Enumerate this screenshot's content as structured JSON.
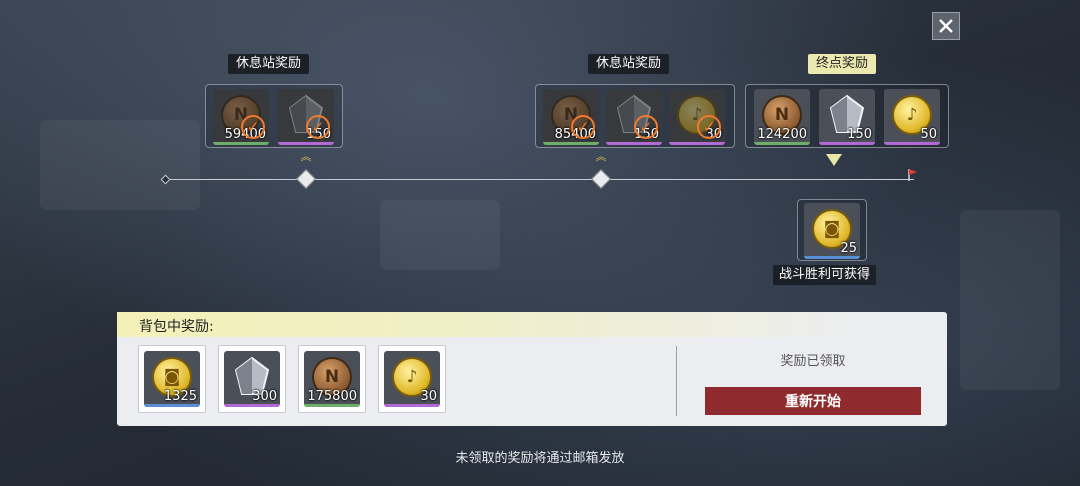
{
  "close_icon": "close-icon",
  "stations": [
    {
      "title": "休息站奖励",
      "items": [
        {
          "icon": "bronze-coin-icon",
          "qty": "59400",
          "claimed": true
        },
        {
          "icon": "crystal-icon",
          "qty": "150",
          "claimed": true
        }
      ]
    },
    {
      "title": "休息站奖励",
      "items": [
        {
          "icon": "bronze-coin-icon",
          "qty": "85400",
          "claimed": true
        },
        {
          "icon": "crystal-icon",
          "qty": "150",
          "claimed": true
        },
        {
          "icon": "music-coin-icon",
          "qty": "30",
          "claimed": true
        }
      ]
    }
  ],
  "final": {
    "title": "终点奖励",
    "items": [
      {
        "icon": "bronze-coin-icon",
        "qty": "124200"
      },
      {
        "icon": "crystal-icon",
        "qty": "150"
      },
      {
        "icon": "music-coin-icon",
        "qty": "50"
      }
    ]
  },
  "victory": {
    "label": "战斗胜利可获得",
    "item": {
      "icon": "gold-bag-coin-icon",
      "qty": "25"
    }
  },
  "backpack": {
    "title": "背包中奖励:",
    "items": [
      {
        "icon": "gold-bag-coin-icon",
        "qty": "1325"
      },
      {
        "icon": "crystal-icon",
        "qty": "300"
      },
      {
        "icon": "bronze-coin-icon",
        "qty": "175800"
      },
      {
        "icon": "music-coin-icon",
        "qty": "30"
      }
    ],
    "status": "奖励已领取",
    "restart_label": "重新开始"
  },
  "footer_note": "未领取的奖励将通过邮箱发放",
  "colors": {
    "accent_orange": "#f07a2a",
    "restart_red": "#8f2b2e",
    "final_label_bg": "#ece9b0"
  }
}
